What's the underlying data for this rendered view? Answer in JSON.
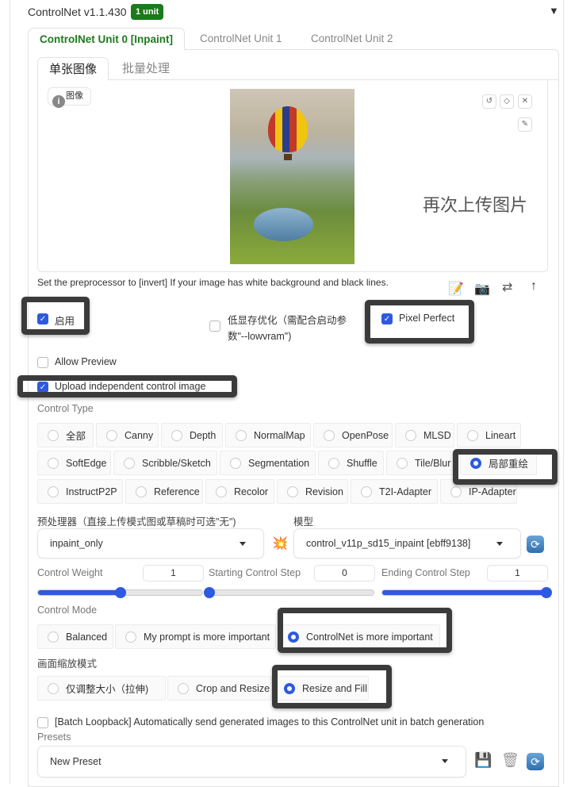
{
  "header": {
    "title": "ControlNet v1.1.430",
    "badge": "1 unit",
    "collapse_icon": "triangle-down-icon"
  },
  "unit_tabs": [
    {
      "label": "ControlNet Unit 0 [Inpaint]",
      "active": true
    },
    {
      "label": "ControlNet Unit 1"
    },
    {
      "label": "ControlNet Unit 2"
    }
  ],
  "image_tabs": [
    {
      "label": "单张图像",
      "active": true
    },
    {
      "label": "批量处理"
    }
  ],
  "image_panel": {
    "label": "图像",
    "overlay_text": "再次上传图片",
    "buttons": [
      "undo-icon",
      "eraser-icon",
      "close-icon",
      "brush-icon"
    ]
  },
  "hint": "Set the preprocessor to [invert] If your image has white background and black lines.",
  "hint_buttons": [
    "edit-icon",
    "camera-icon",
    "swap-icon",
    "upload-arrow-icon"
  ],
  "checkboxes": {
    "enable": {
      "label": "启用",
      "checked": true
    },
    "lowvram": {
      "label1": "低显存优化（需配合启动参",
      "label2": "数\"--lowvram\")",
      "checked": false
    },
    "pixel_perfect": {
      "label": "Pixel Perfect",
      "checked": true
    },
    "allow_preview": {
      "label": "Allow Preview",
      "checked": false
    },
    "upload_independent": {
      "label": "Upload independent control image",
      "checked": true
    }
  },
  "control_type": {
    "label": "Control Type",
    "selected": "局部重绘",
    "rows": [
      [
        "全部",
        "Canny",
        "Depth",
        "NormalMap",
        "OpenPose",
        "MLSD",
        "Lineart"
      ],
      [
        "SoftEdge",
        "Scribble/Sketch",
        "Segmentation",
        "Shuffle",
        "Tile/Blur",
        "局部重绘"
      ],
      [
        "InstructP2P",
        "Reference",
        "Recolor",
        "Revision",
        "T2I-Adapter",
        "IP-Adapter"
      ]
    ]
  },
  "preprocessor": {
    "label": "预处理器（直接上传模式图或草稿时可选\"无\")",
    "value": "inpaint_only"
  },
  "model": {
    "label": "模型",
    "value": "control_v11p_sd15_inpaint [ebff9138]"
  },
  "sliders": [
    {
      "label": "Control Weight",
      "value": "1",
      "min": 0,
      "max": 2
    },
    {
      "label": "Starting Control Step",
      "value": "0",
      "min": 0,
      "max": 1
    },
    {
      "label": "Ending Control Step",
      "value": "1",
      "min": 0,
      "max": 1
    }
  ],
  "control_mode": {
    "label": "Control Mode",
    "options": [
      "Balanced",
      "My prompt is more important",
      "ControlNet is more important"
    ],
    "selected": "ControlNet is more important"
  },
  "resize_mode": {
    "label": "画面缩放模式",
    "options": [
      "仅调整大小（拉伸)",
      "Crop and Resize",
      "Resize and Fill"
    ],
    "selected": "Resize and Fill"
  },
  "batch_loopback": {
    "label": "[Batch Loopback] Automatically send generated images to this ControlNet unit in batch generation",
    "checked": false
  },
  "presets": {
    "label": "Presets",
    "value": "New Preset",
    "buttons": [
      "save-icon",
      "trash-icon",
      "refresh-icon"
    ]
  },
  "colors": {
    "accent": "#2d5ae0",
    "badge": "#1b7a1b",
    "active_tab": "#1e7a1e"
  }
}
